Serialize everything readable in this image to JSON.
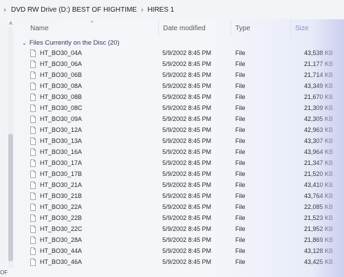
{
  "address_bar": {
    "crumbs": [
      "DVD RW Drive (D:) BEST OF HIGHTIME",
      "HIRES 1"
    ]
  },
  "columns": {
    "name": "Name",
    "date": "Date modified",
    "type": "Type",
    "size": "Size"
  },
  "group": {
    "label": "Files Currently on the Disc (20)"
  },
  "files": [
    {
      "name": "HT_BO30_04A",
      "date": "5/9/2002 8:45 PM",
      "type": "File",
      "size": "43,538 KB"
    },
    {
      "name": "HT_BO30_06A",
      "date": "5/9/2002 8:45 PM",
      "type": "File",
      "size": "21,177 KB"
    },
    {
      "name": "HT_BO30_06B",
      "date": "5/9/2002 8:45 PM",
      "type": "File",
      "size": "21,714 KB"
    },
    {
      "name": "HT_BO30_08A",
      "date": "5/9/2002 8:45 PM",
      "type": "File",
      "size": "43,349 KB"
    },
    {
      "name": "HT_BO30_08B",
      "date": "5/9/2002 8:45 PM",
      "type": "File",
      "size": "21,670 KB"
    },
    {
      "name": "HT_BO30_08C",
      "date": "5/9/2002 8:45 PM",
      "type": "File",
      "size": "21,309 KB"
    },
    {
      "name": "HT_BO30_09A",
      "date": "5/9/2002 8:45 PM",
      "type": "File",
      "size": "42,305 KB"
    },
    {
      "name": "HT_BO30_12A",
      "date": "5/9/2002 8:45 PM",
      "type": "File",
      "size": "42,963 KB"
    },
    {
      "name": "HT_BO30_13A",
      "date": "5/9/2002 8:45 PM",
      "type": "File",
      "size": "43,307 KB"
    },
    {
      "name": "HT_BO30_16A",
      "date": "5/9/2002 8:45 PM",
      "type": "File",
      "size": "43,964 KB"
    },
    {
      "name": "HT_BO30_17A",
      "date": "5/9/2002 8:45 PM",
      "type": "File",
      "size": "21,347 KB"
    },
    {
      "name": "HT_BO30_17B",
      "date": "5/9/2002 8:45 PM",
      "type": "File",
      "size": "21,520 KB"
    },
    {
      "name": "HT_BO30_21A",
      "date": "5/9/2002 8:45 PM",
      "type": "File",
      "size": "43,410 KB"
    },
    {
      "name": "HT_BO30_21B",
      "date": "5/9/2002 8:45 PM",
      "type": "File",
      "size": "43,764 KB"
    },
    {
      "name": "HT_BO30_22A",
      "date": "5/9/2002 8:45 PM",
      "type": "File",
      "size": "22,085 KB"
    },
    {
      "name": "HT_BO30_22B",
      "date": "5/9/2002 8:45 PM",
      "type": "File",
      "size": "21,523 KB"
    },
    {
      "name": "HT_BO30_22C",
      "date": "5/9/2002 8:45 PM",
      "type": "File",
      "size": "21,952 KB"
    },
    {
      "name": "HT_BO30_28A",
      "date": "5/9/2002 8:45 PM",
      "type": "File",
      "size": "21,869 KB"
    },
    {
      "name": "HT_BO30_44A",
      "date": "5/9/2002 8:45 PM",
      "type": "File",
      "size": "43,128 KB"
    },
    {
      "name": "HT_BO30_46A",
      "date": "5/9/2002 8:45 PM",
      "type": "File",
      "size": "43,425 KB"
    }
  ],
  "bottom_left_label": "OF",
  "icons": {
    "file": "file-icon",
    "chevron_right": "chevron-right-icon",
    "chevron_up": "chevron-up-icon",
    "sort_caret": "sort-up-icon"
  }
}
